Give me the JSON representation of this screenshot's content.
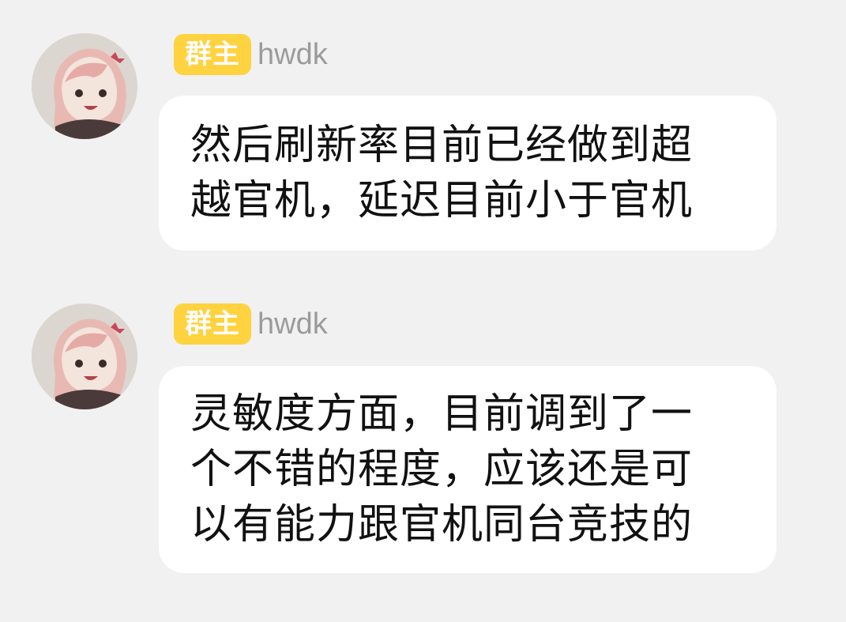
{
  "messages": [
    {
      "badge": "群主",
      "sender": "hwdk",
      "text": "然后刷新率目前已经做到超\n越官机，延迟目前小于官机"
    },
    {
      "badge": "群主",
      "sender": "hwdk",
      "text": "灵敏度方面，目前调到了一\n个不错的程度，应该还是可\n以有能力跟官机同台竞技的"
    }
  ],
  "colors": {
    "background": "#f1f1f1",
    "badge": "#ffd23f",
    "bubble": "#ffffff",
    "sender_name": "#9b9b9b"
  }
}
